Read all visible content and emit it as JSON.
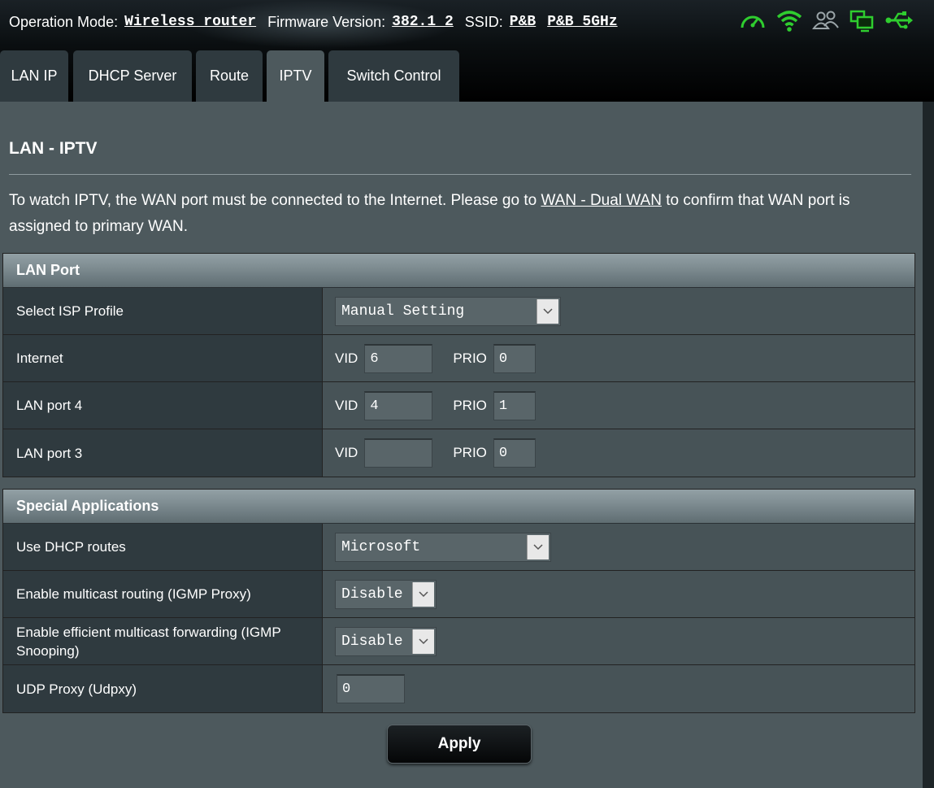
{
  "status": {
    "operation_mode_label": "Operation Mode:",
    "operation_mode_value": "Wireless router",
    "firmware_label": "Firmware Version:",
    "firmware_value": "382.1_2",
    "ssid_label": "SSID:",
    "ssid_1": "P&B",
    "ssid_2": "P&B_5GHz",
    "icons": [
      "speedometer-icon",
      "wifi-icon",
      "users-icon",
      "network-devices-icon",
      "usb-icon"
    ],
    "icon_color": "#2fcd2f"
  },
  "tabs": [
    {
      "label": "LAN IP"
    },
    {
      "label": "DHCP Server"
    },
    {
      "label": "Route"
    },
    {
      "label": "IPTV",
      "active": true
    },
    {
      "label": "Switch Control"
    }
  ],
  "page": {
    "title": "LAN - IPTV",
    "intro_before": "To watch IPTV, the WAN port must be connected to the Internet. Please go to ",
    "intro_link": "WAN - Dual WAN",
    "intro_after": " to confirm that WAN port is assigned to primary WAN."
  },
  "lan_port": {
    "header": "LAN Port",
    "isp_profile_label": "Select ISP Profile",
    "isp_profile_value": "Manual Setting",
    "vid_label": "VID",
    "prio_label": "PRIO",
    "rows": [
      {
        "label": "Internet",
        "vid": "6",
        "prio": "0"
      },
      {
        "label": "LAN port 4",
        "vid": "4",
        "prio": "1"
      },
      {
        "label": "LAN port 3",
        "vid": "",
        "prio": "0"
      }
    ]
  },
  "special": {
    "header": "Special Applications",
    "dhcp_routes_label": "Use DHCP routes",
    "dhcp_routes_value": "Microsoft",
    "igmp_proxy_label": "Enable multicast routing (IGMP Proxy)",
    "igmp_proxy_value": "Disable",
    "igmp_snooping_label": "Enable efficient multicast forwarding (IGMP Snooping)",
    "igmp_snooping_value": "Disable",
    "udpxy_label": "UDP Proxy (Udpxy)",
    "udpxy_value": "0"
  },
  "apply_label": "Apply",
  "colors": {
    "panel": "#4d595d",
    "row_label_bg": "#2f3a3f",
    "row_value_bg": "#475357",
    "tab_bg": "#2f3a3f"
  }
}
